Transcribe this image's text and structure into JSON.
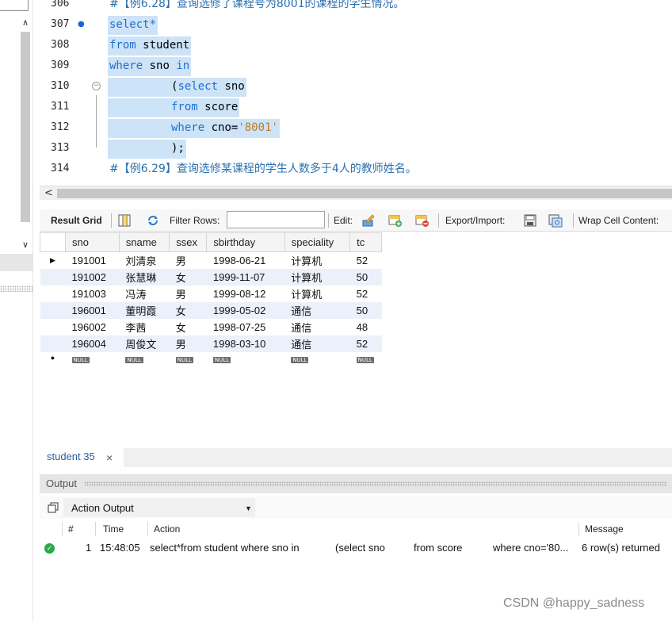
{
  "editor": {
    "lines": [
      {
        "num": "306",
        "comment": "#【例6.28】查询选修了课程号为8001的课程的学生情况。"
      },
      {
        "num": "307",
        "kw": "select*"
      },
      {
        "num": "308",
        "kw": "from",
        "rest": " student"
      },
      {
        "num": "309",
        "kw": "where",
        "rest": " sno ",
        "kw2": "in"
      },
      {
        "num": "310",
        "prefix": "(",
        "kw": "select",
        "rest": " sno"
      },
      {
        "num": "311",
        "kw": "from",
        "rest": " score"
      },
      {
        "num": "312",
        "kw": "where",
        "rest": " cno=",
        "str": "'8001'"
      },
      {
        "num": "313",
        "rest": ");"
      },
      {
        "num": "314",
        "comment": "#【例6.29】查询选修某课程的学生人数多于4人的教师姓名。"
      }
    ]
  },
  "toolbar": {
    "result_grid": "Result Grid",
    "filter_rows": "Filter Rows:",
    "edit": "Edit:",
    "export_import": "Export/Import:",
    "wrap_cell": "Wrap Cell Content:"
  },
  "grid": {
    "columns": [
      "sno",
      "sname",
      "ssex",
      "sbirthday",
      "speciality",
      "tc"
    ],
    "rows": [
      [
        "191001",
        "刘清泉",
        "男",
        "1998-06-21",
        "计算机",
        "52"
      ],
      [
        "191002",
        "张慧琳",
        "女",
        "1999-11-07",
        "计算机",
        "50"
      ],
      [
        "191003",
        "冯涛",
        "男",
        "1999-08-12",
        "计算机",
        "52"
      ],
      [
        "196001",
        "董明霞",
        "女",
        "1999-05-02",
        "通信",
        "50"
      ],
      [
        "196002",
        "李茜",
        "女",
        "1998-07-25",
        "通信",
        "48"
      ],
      [
        "196004",
        "周俊文",
        "男",
        "1998-03-10",
        "通信",
        "52"
      ]
    ],
    "null_label": "NULL"
  },
  "tabs": {
    "student": "student 35",
    "close": "×"
  },
  "output": {
    "title": "Output",
    "selector": "Action Output",
    "columns": {
      "num": "#",
      "time": "Time",
      "action": "Action",
      "message": "Message"
    },
    "row": {
      "num": "1",
      "time": "15:48:05",
      "action_1": "select*from student where sno in",
      "action_2": "(select sno",
      "action_3": "from score",
      "action_4": "where cno='80...",
      "message": "6 row(s) returned"
    }
  },
  "watermark": "CSDN @happy_sadness",
  "colors": {
    "keyword": "#1f6fd1",
    "string": "#c47a23",
    "selection": "#cde3f7",
    "alt_row": "#eaf1fb",
    "success": "#2aa84a"
  }
}
